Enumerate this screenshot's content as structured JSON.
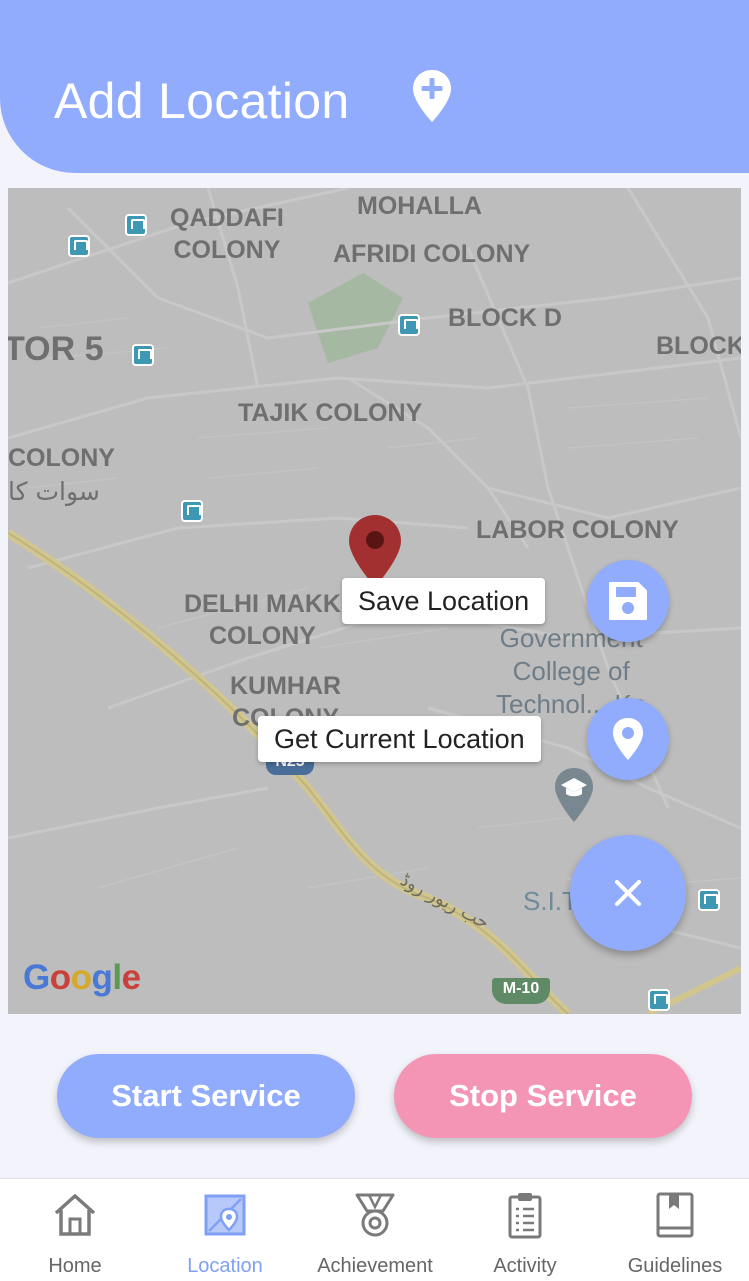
{
  "header": {
    "title": "Add Location",
    "icon": "add-location-icon"
  },
  "map": {
    "area_labels": [
      {
        "key": "qaddafi",
        "text": "QADDAFI\nCOLONY"
      },
      {
        "key": "mohalla",
        "text": "MOHALLA"
      },
      {
        "key": "afridi",
        "text": "AFRIDI COLONY"
      },
      {
        "key": "blockd",
        "text": "BLOCK D"
      },
      {
        "key": "block",
        "text": "BLOCK"
      },
      {
        "key": "tor5",
        "text": "TOR 5"
      },
      {
        "key": "tajik",
        "text": "TAJIK COLONY"
      },
      {
        "key": "colony_left",
        "text": "COLONY"
      },
      {
        "key": "urdu_colony",
        "text": "سوات کا"
      },
      {
        "key": "labor",
        "text": "LABOR COLONY"
      },
      {
        "key": "delhi",
        "text": "DELHI MAKK\nCOLONY"
      },
      {
        "key": "kumhar",
        "text": "KUMHAR\nCOLONY"
      }
    ],
    "poi": {
      "college": "Government\nCollege of\nTechnol... Ka",
      "sit": "S.I.T... n"
    },
    "road_shields": {
      "n25": "N25",
      "m10": "M-10"
    },
    "road_name": "حب ریور روڈ",
    "attribution": "Google"
  },
  "fab_menu": {
    "save_label": "Save Location",
    "current_label": "Get Current Location",
    "close_icon": "close-icon"
  },
  "service": {
    "start_label": "Start Service",
    "stop_label": "Stop Service"
  },
  "nav": {
    "items": [
      {
        "label": "Home",
        "icon": "home-icon"
      },
      {
        "label": "Location",
        "icon": "map-location-icon",
        "active": true
      },
      {
        "label": "Achievement",
        "icon": "medal-icon"
      },
      {
        "label": "Activity",
        "icon": "clipboard-icon"
      },
      {
        "label": "Guidelines",
        "icon": "book-icon"
      }
    ]
  },
  "colors": {
    "primary": "#92acfd",
    "stop": "#f495b6",
    "active_nav": "#7fa0f4",
    "pin": "#a33030"
  }
}
